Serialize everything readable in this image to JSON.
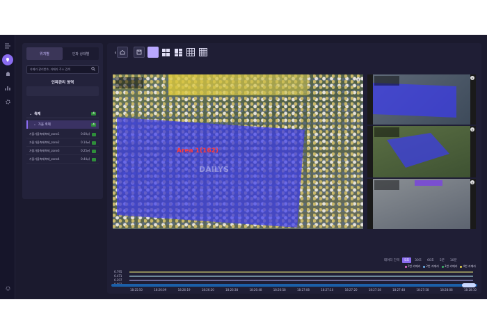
{
  "rail": {
    "icons": [
      "menu-icon",
      "location-pin-icon",
      "alarm-icon",
      "bar-chart-icon",
      "gear-icon",
      "settings-cog-icon"
    ]
  },
  "sidebar": {
    "tabs": [
      {
        "label": "위치별",
        "active": true
      },
      {
        "label": "인파 상태별",
        "active": false
      }
    ],
    "search_placeholder": "카메라 관리번호, 카메라 주소 검색",
    "title": "인파관리 영역",
    "group": {
      "label": "축제",
      "count": "4"
    },
    "subgroup": {
      "label": "가을 축제",
      "count": "4"
    },
    "zones": [
      {
        "name": "가을가을축제축제_zone1",
        "value": "0.00㎡"
      },
      {
        "name": "가을가을축제축제_zone2",
        "value": "0.14㎡"
      },
      {
        "name": "가을가을축제축제_zone3",
        "value": "0.25㎡"
      },
      {
        "name": "가을가을축제축제_zone4",
        "value": "0.44㎡"
      }
    ]
  },
  "toolbar": {
    "layout_options": [
      "1x1",
      "2x2",
      "1+5",
      "3x3",
      "4x4"
    ],
    "selected_layout": "1x1"
  },
  "video": {
    "heat_label": "Area 1(162)",
    "watermark": "DAILYS"
  },
  "timeline": {
    "interval_label": "데이터 간격",
    "intervals": [
      "5초",
      "30초",
      "60초",
      "5분",
      "10분"
    ],
    "selected_interval": "5초",
    "legend": [
      {
        "label": "1번 카메라",
        "color": "#e46cc8"
      },
      {
        "label": "2번 카메라",
        "color": "#6fb6f0"
      },
      {
        "label": "3번 카메라",
        "color": "#3fb86a"
      },
      {
        "label": "4번 카메라",
        "color": "#e8d44a"
      }
    ],
    "y_labels": [
      "6.795",
      "6.471",
      "6.207",
      "0.003"
    ],
    "x_labels": [
      "18:25:50",
      "18:26:09",
      "18:26:19",
      "18:26:20",
      "18:26:38",
      "18:26:48",
      "18:26:58",
      "18:27:08",
      "18:27:10",
      "18:27:20",
      "18:27:38",
      "18:27:48",
      "18:27:58",
      "18:28:08",
      "18:28:10"
    ],
    "track_colors": [
      "#8a8a5a",
      "#6e8a9a",
      "#6a6a9a",
      "#8a6a8a"
    ]
  }
}
